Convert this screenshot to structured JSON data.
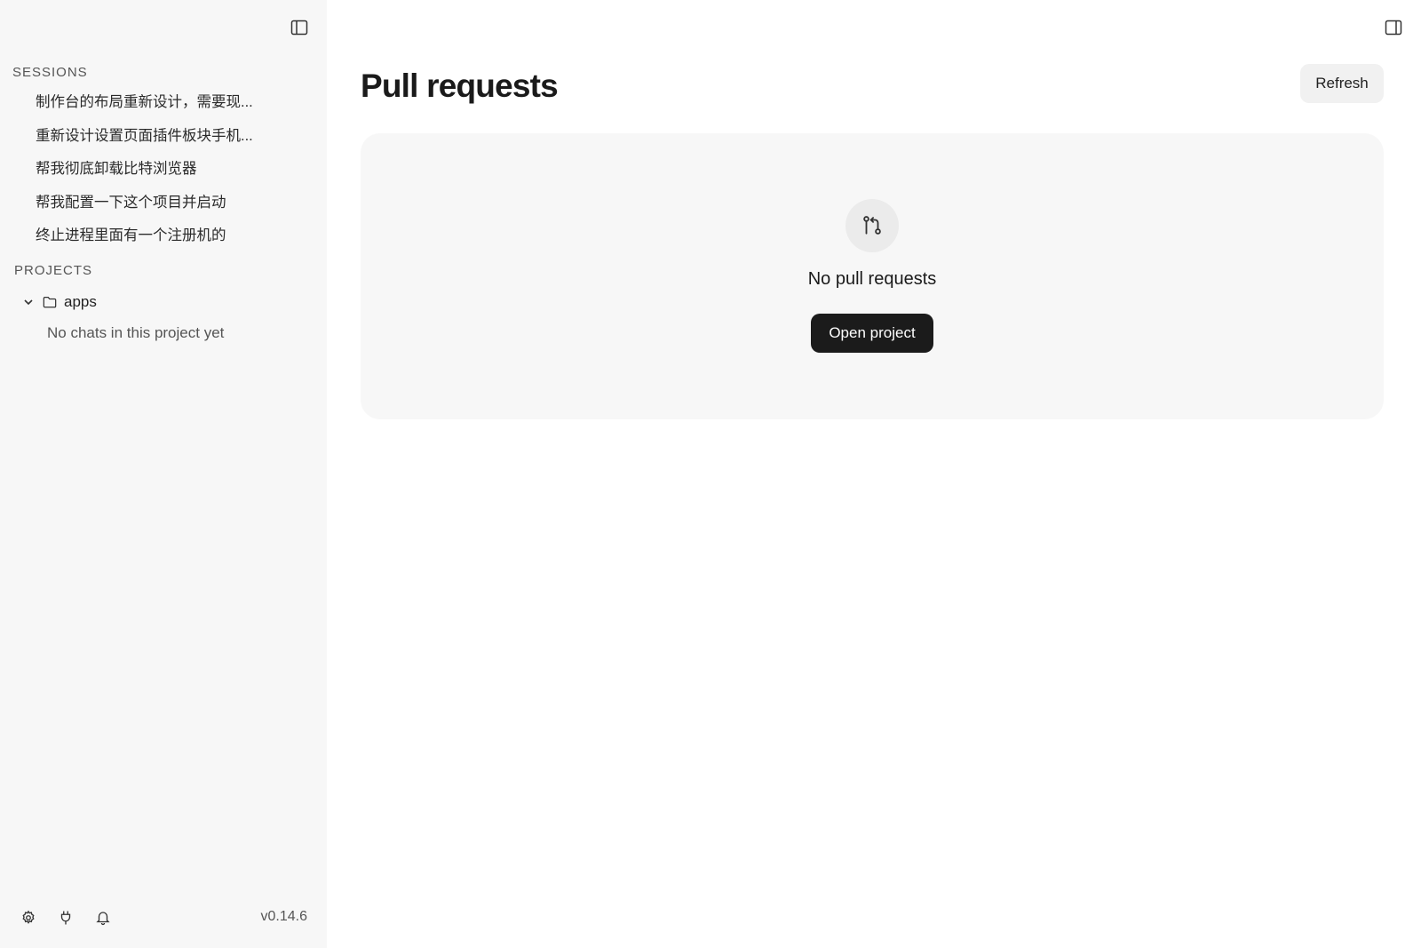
{
  "sidebar": {
    "sessions_label": "SESSIONS",
    "sessions": [
      "制作台的布局重新设计，需要现...",
      "重新设计设置页面插件板块手机...",
      "帮我彻底卸载比特浏览器",
      "帮我配置一下这个项目并启动",
      "终止进程里面有一个注册机的"
    ],
    "projects_label": "PROJECTS",
    "project": {
      "name": "apps",
      "empty_text": "No chats in this project yet"
    },
    "footer": {
      "version": "v0.14.6",
      "icons": [
        "gear-icon",
        "plug-icon",
        "bell-icon"
      ]
    }
  },
  "main": {
    "title": "Pull requests",
    "refresh_label": "Refresh",
    "empty_state": {
      "icon": "git-pull-request-icon",
      "title": "No pull requests",
      "button_label": "Open project"
    }
  }
}
